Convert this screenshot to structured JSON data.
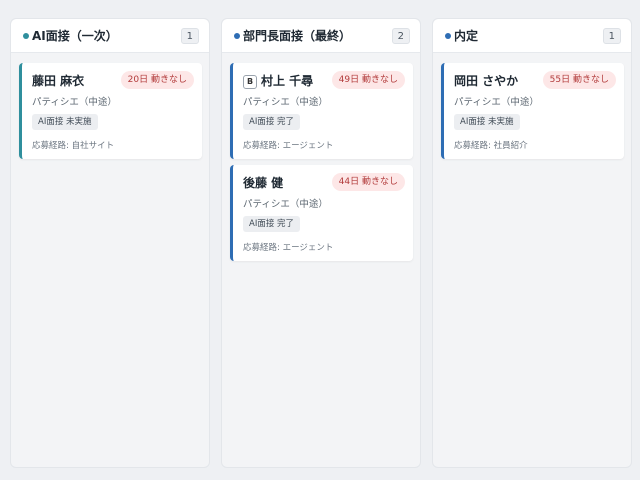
{
  "colors": {
    "teal": "#2f8f9d",
    "blue": "#2e6db4",
    "alert_bg": "#fde7e7",
    "alert_text": "#b23b3b"
  },
  "columns": [
    {
      "title": "AI面接（一次）",
      "count": "1",
      "dot_color": "#2f8f9d",
      "cards": [
        {
          "name": "藤田 麻衣",
          "badge": "20日 動きなし",
          "role": "パティシエ（中途）",
          "status": "AI面接 未実施",
          "source": "応募経路: 自社サイト"
        }
      ]
    },
    {
      "title": "部門長面接（最終）",
      "count": "2",
      "dot_color": "#2e6db4",
      "cards": [
        {
          "tag": "B",
          "name": "村上 千尋",
          "badge": "49日 動きなし",
          "role": "パティシエ（中途）",
          "status": "AI面接 完了",
          "source": "応募経路: エージェント"
        },
        {
          "name": "後藤 健",
          "badge": "44日 動きなし",
          "role": "パティシエ（中途）",
          "status": "AI面接 完了",
          "source": "応募経路: エージェント"
        }
      ]
    },
    {
      "title": "内定",
      "count": "1",
      "dot_color": "#2e6db4",
      "cards": [
        {
          "name": "岡田 さやか",
          "badge": "55日 動きなし",
          "role": "パティシエ（中途）",
          "status": "AI面接 未実施",
          "source": "応募経路: 社員紹介"
        }
      ]
    }
  ]
}
